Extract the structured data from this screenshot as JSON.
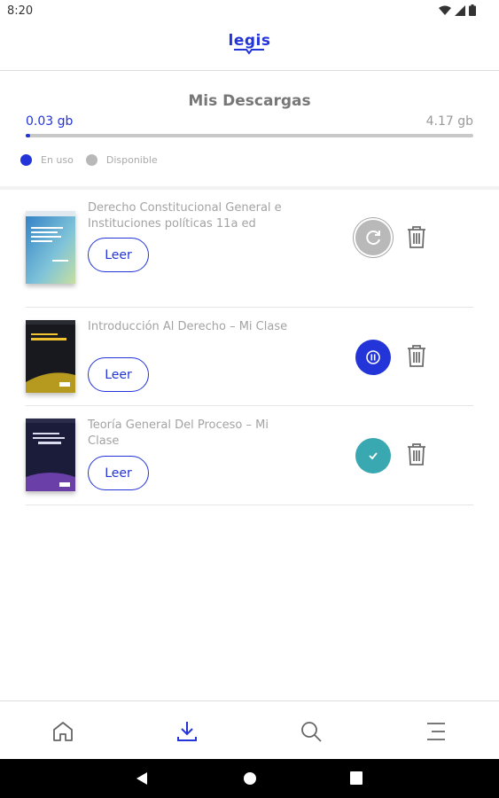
{
  "status_bar": {
    "time": "8:20"
  },
  "header": {
    "logo": "legis"
  },
  "storage": {
    "title": "Mis Descargas",
    "used": "0.03 gb",
    "total": "4.17 gb",
    "used_fraction": 0.01,
    "legend": [
      {
        "label": "En uso",
        "color": "#2334d8"
      },
      {
        "label": "Disponible",
        "color": "#b8b8b8"
      }
    ]
  },
  "books": [
    {
      "title": "Derecho Constitucional General e Instituciones políticas 11a ed",
      "read_label": "Leer",
      "status": "retry",
      "status_icon": "refresh-icon"
    },
    {
      "title": "Introducción Al Derecho  – Mi Clase",
      "read_label": "Leer",
      "status": "downloading",
      "status_icon": "pause-icon"
    },
    {
      "title": "Teoría General Del Proceso – Mi Clase",
      "read_label": "Leer",
      "status": "downloaded",
      "status_icon": "check-icon"
    }
  ],
  "bottom_nav": [
    {
      "name": "home",
      "icon": "home-icon",
      "active": false
    },
    {
      "name": "downloads",
      "icon": "download-icon",
      "active": true
    },
    {
      "name": "search",
      "icon": "search-icon",
      "active": false
    },
    {
      "name": "menu",
      "icon": "menu-icon",
      "active": false
    }
  ],
  "colors": {
    "accent": "#2334d8",
    "retry": "#b9b9b9",
    "downloaded": "#3aa8b0"
  }
}
